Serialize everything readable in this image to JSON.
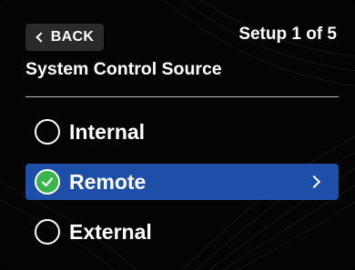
{
  "header": {
    "back_label": "BACK",
    "step_label": "Setup 1 of 5"
  },
  "title": "System Control Source",
  "options": [
    {
      "label": "Internal",
      "selected": false
    },
    {
      "label": "Remote",
      "selected": true
    },
    {
      "label": "External",
      "selected": false
    }
  ],
  "colors": {
    "background": "#040404",
    "selection": "#1d4fa8",
    "check": "#3ab34a",
    "back_button": "#2a2a2a"
  },
  "icons": {
    "back": "chevron-left-icon",
    "check": "check-icon",
    "forward": "chevron-right-icon"
  }
}
